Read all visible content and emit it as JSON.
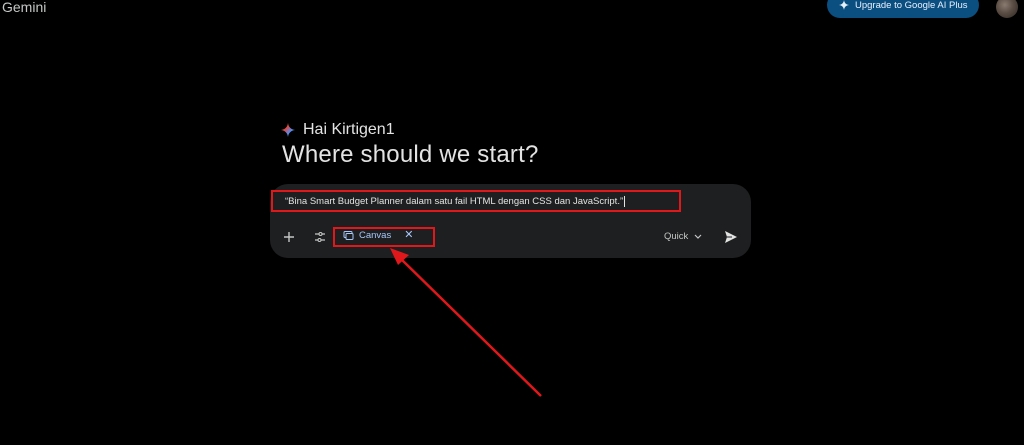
{
  "app": {
    "title": "Gemini"
  },
  "header": {
    "upgrade_label": "Upgrade to Google AI Plus",
    "upgrade_icon": "sparkle-icon"
  },
  "main": {
    "greeting": "Hai Kirtigen1",
    "headline": "Where should we start?"
  },
  "composer": {
    "prompt_text": "“Bina Smart Budget Planner dalam satu fail HTML dengan CSS dan JavaScript.”",
    "add_icon": "plus-icon",
    "tools_icon": "tune-icon",
    "chip": {
      "label": "Canvas",
      "icon": "canvas-icon",
      "close": "✕"
    },
    "mode_label": "Quick",
    "send_icon": "send-icon"
  },
  "colors": {
    "background": "#000000",
    "card": "#1e1f20",
    "accent": "#0b4f80",
    "chip_text": "#a8c7fa",
    "annotation": "#e0181b"
  }
}
